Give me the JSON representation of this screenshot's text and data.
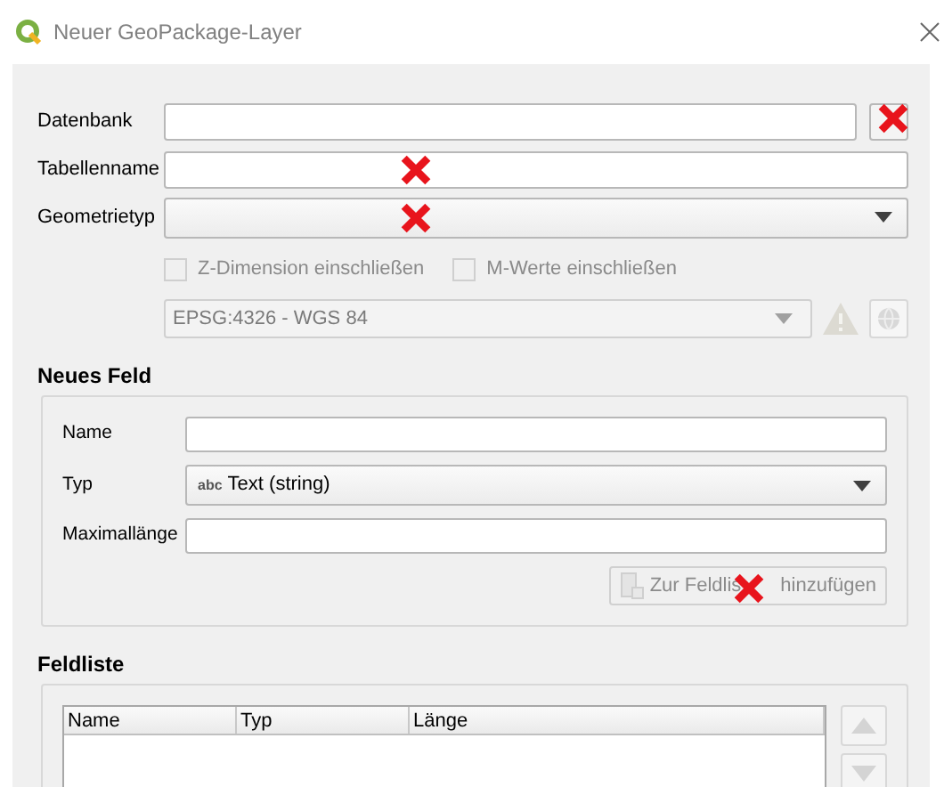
{
  "window": {
    "title": "Neuer GeoPackage-Layer"
  },
  "fields": [
    {
      "label": "Datenbank",
      "kind": "file",
      "marked": true
    },
    {
      "label": "Tabellenname",
      "kind": "text",
      "marked": true
    },
    {
      "label": "Geometrietyp",
      "kind": "combo",
      "marked": true
    }
  ],
  "options": [
    {
      "label": "Z-Dimension einschließen",
      "checked": false,
      "disabled": true
    },
    {
      "label": "M-Werte einschließen",
      "checked": false,
      "disabled": true
    }
  ],
  "crs": {
    "value": "EPSG:4326 - WGS 84",
    "disabled": true
  },
  "new_field": {
    "title": "Neues Feld",
    "fields": [
      {
        "label": "Name",
        "kind": "text"
      },
      {
        "label": "Typ",
        "kind": "combo",
        "type_badge": "abc",
        "value": "Text (string)"
      },
      {
        "label": "Maximallänge",
        "kind": "text"
      }
    ],
    "add_button": {
      "label_parts": [
        "Zur Feldlis",
        "hinzufügen"
      ],
      "disabled": true,
      "marked": true
    }
  },
  "field_list": {
    "title": "Feldliste",
    "columns": [
      "Name",
      "Typ",
      "Länge"
    ]
  }
}
